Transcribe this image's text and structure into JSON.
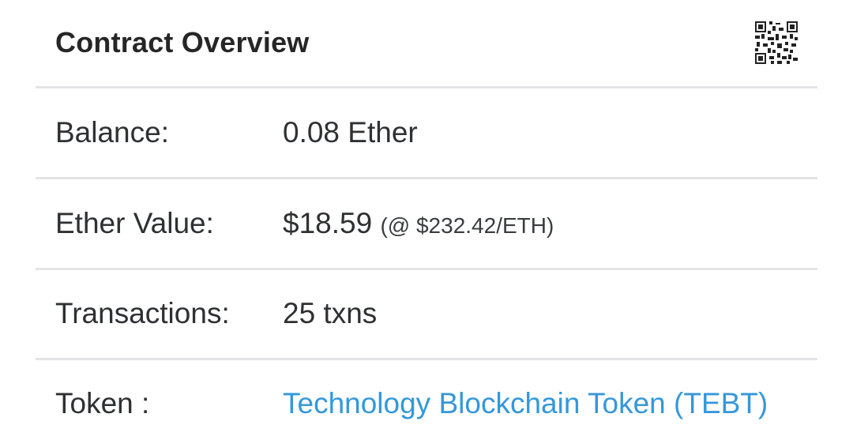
{
  "overview": {
    "title": "Contract Overview",
    "qr_icon": "qr-code-icon"
  },
  "rows": [
    {
      "label": "Balance:",
      "value": "0.08 Ether"
    },
    {
      "label": "Ether Value:",
      "value": "$18.59",
      "note": "(@ $232.42/ETH)"
    },
    {
      "label": "Transactions:",
      "value": "25 txns"
    },
    {
      "label": "Token :",
      "value": "Technology Blockchain Token (TEBT)"
    }
  ],
  "colors": {
    "link": "#3498db",
    "divider": "#e3e4e6",
    "text": "#2e3033"
  }
}
